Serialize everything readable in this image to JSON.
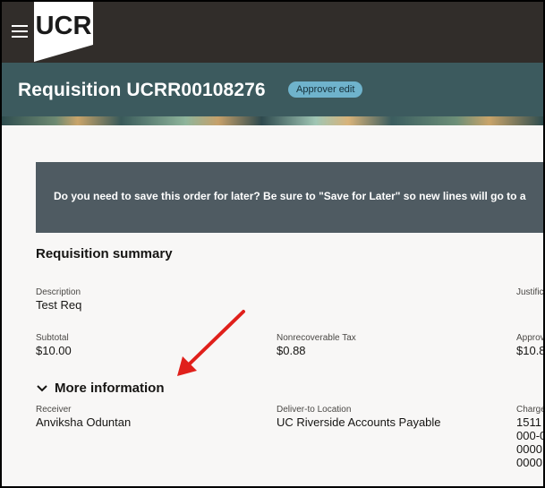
{
  "app": {
    "logo_text": "UCR"
  },
  "header": {
    "title": "Requisition UCRR00108276",
    "badge": "Approver edit"
  },
  "notice": {
    "text": "Do you need to save this order for later? Be sure to \"Save for Later\" so new lines will go to a"
  },
  "summary": {
    "title": "Requisition summary",
    "description": {
      "label": "Description",
      "value": "Test Req"
    },
    "justification": {
      "label": "Justific"
    },
    "subtotal": {
      "label": "Subtotal",
      "value": "$10.00"
    },
    "nonrecoverable_tax": {
      "label": "Nonrecoverable Tax",
      "value": "$0.88"
    },
    "approval": {
      "label": "Approv",
      "value": "$10.8"
    }
  },
  "more_information": {
    "toggle_label": "More information",
    "receiver": {
      "label": "Receiver",
      "value": "Anviksha Oduntan"
    },
    "deliver_to": {
      "label": "Deliver-to Location",
      "value": "UC Riverside Accounts Payable"
    },
    "charge_account": {
      "label": "Charge",
      "lines": [
        "1511",
        "000-0",
        "0000",
        "0000"
      ]
    }
  },
  "colors": {
    "topbar": "#312d2a",
    "banner": "#3c5a5e",
    "notice": "#4f5b62",
    "badge": "#6fb3cc",
    "annotation_arrow": "#e0201b"
  },
  "icons": {
    "menu": "hamburger-menu-icon",
    "expand": "chevron-down-icon",
    "annotation": "red-arrow"
  }
}
